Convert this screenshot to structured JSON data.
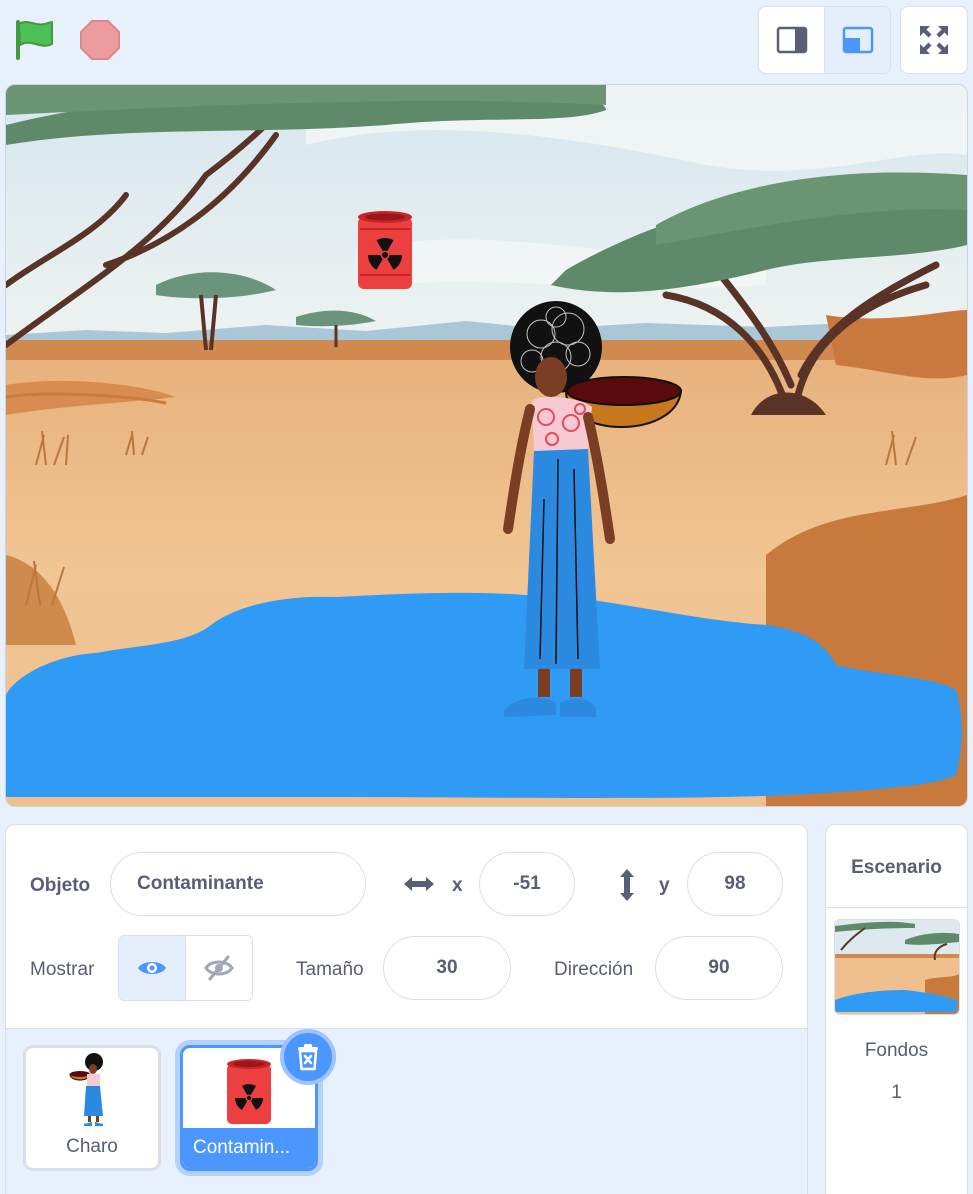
{
  "toolbar": {
    "green_flag": "green-flag-icon",
    "stop": "stop-icon",
    "small_stage": "small-stage-icon",
    "normal_stage": "normal-stage-icon",
    "fullscreen": "fullscreen-icon"
  },
  "sprite_info": {
    "sprite_label": "Objeto",
    "sprite_name": "Contaminante",
    "x_label": "x",
    "x_value": "-51",
    "y_label": "y",
    "y_value": "98",
    "show_label": "Mostrar",
    "size_label": "Tamaño",
    "size_value": "30",
    "direction_label": "Dirección",
    "direction_value": "90"
  },
  "sprites": [
    {
      "name": "Charo",
      "selected": false
    },
    {
      "name": "Contamin...",
      "selected": true
    }
  ],
  "stage_panel": {
    "title": "Escenario",
    "backdrops_label": "Fondos",
    "backdrops_count": "1"
  },
  "colors": {
    "accent": "#4c97ff",
    "water": "#2f9bf5",
    "panel_bg": "#e8f0fb",
    "text": "#575e75"
  }
}
